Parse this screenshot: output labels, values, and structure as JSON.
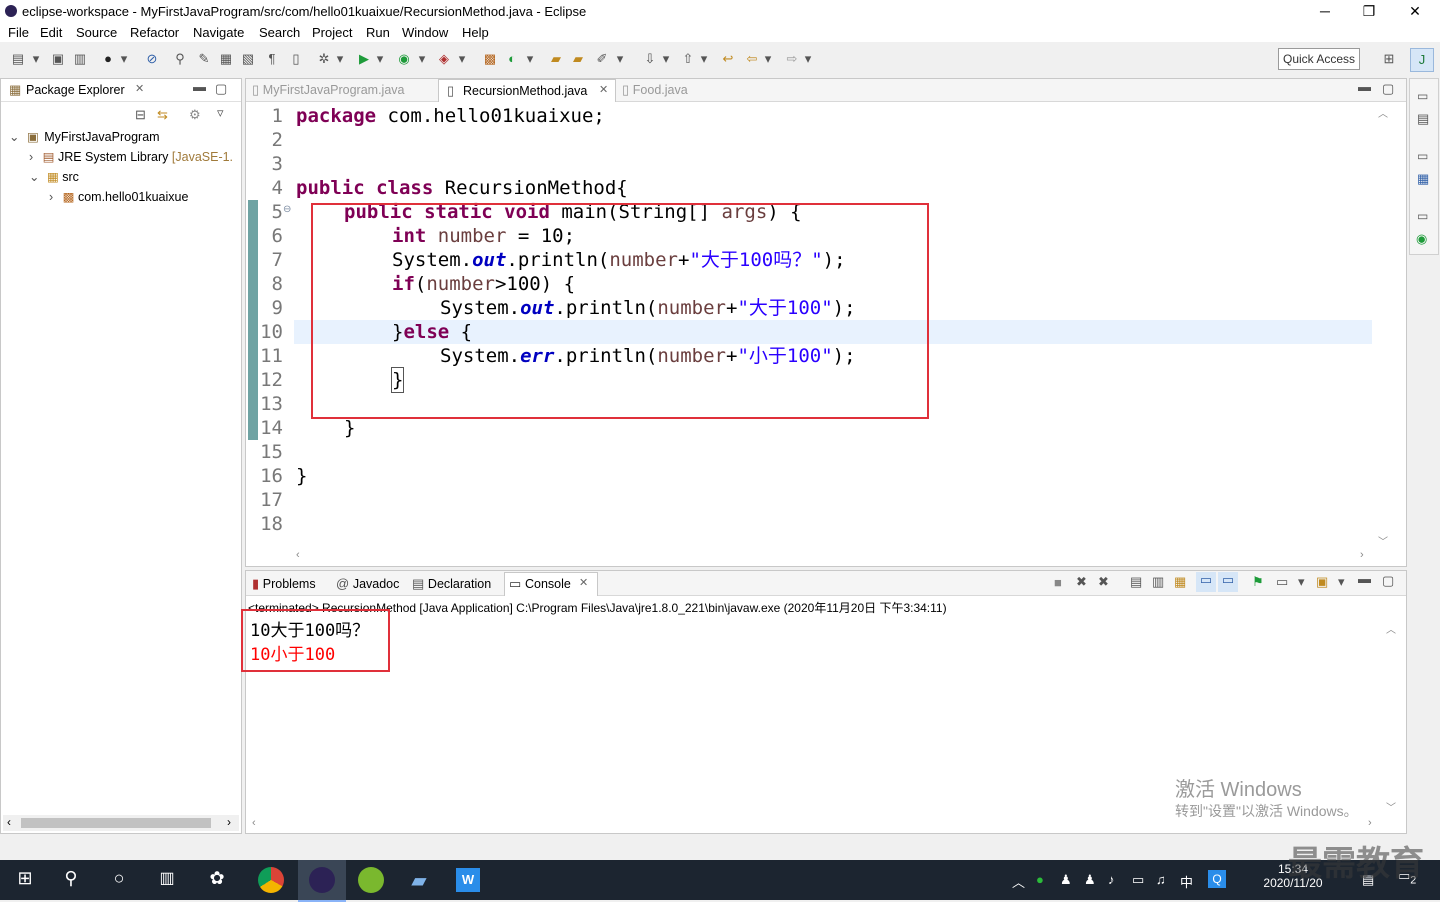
{
  "window": {
    "title": "eclipse-workspace - MyFirstJavaProgram/src/com/hello01kuaixue/RecursionMethod.java - Eclipse"
  },
  "menu": [
    "File",
    "Edit",
    "Source",
    "Refactor",
    "Navigate",
    "Search",
    "Project",
    "Run",
    "Window",
    "Help"
  ],
  "toolbar": {
    "quick_access": "Quick Access"
  },
  "package_explorer": {
    "tab": "Package Explorer",
    "tree": [
      {
        "label": "MyFirstJavaProgram",
        "level": 0,
        "expanded": true
      },
      {
        "label": "JRE System Library",
        "extra": "[JavaSE-1.",
        "level": 1,
        "expanded": false
      },
      {
        "label": "src",
        "level": 1,
        "expanded": true
      },
      {
        "label": "com.hello01kuaixue",
        "level": 2,
        "expanded": false
      }
    ]
  },
  "editor": {
    "tabs": [
      {
        "label": "MyFirstJavaProgram.java",
        "active": false
      },
      {
        "label": "RecursionMethod.java",
        "active": true
      },
      {
        "label": "Food.java",
        "active": false
      }
    ],
    "line_numbers": [
      "1",
      "2",
      "3",
      "4",
      "5",
      "6",
      "7",
      "8",
      "9",
      "10",
      "11",
      "12",
      "13",
      "14",
      "15",
      "16",
      "17",
      "18"
    ],
    "code": {
      "l1_kw": "package",
      "l1_rest": " com.hello01kuaixue;",
      "l4_kw": "public class",
      "l4_rest": " RecursionMethod{",
      "l5_kw": "public static void",
      "l5_rest": " main(String[] ",
      "l5_var": "args",
      "l5_end": ") {",
      "l6_kw": "int",
      "l6_var": " number",
      "l6_rest": " = 10;",
      "l7_a": "System.",
      "l7_it": "out",
      "l7_b": ".println(",
      "l7_var": "number",
      "l7_c": "+",
      "l7_str": "\"大于100吗？\"",
      "l7_d": ");",
      "l8_kw": "if",
      "l8_a": "(",
      "l8_var": "number",
      "l8_b": ">100) {",
      "l9_a": "System.",
      "l9_it": "out",
      "l9_b": ".println(",
      "l9_var": "number",
      "l9_c": "+",
      "l9_str": "\"大于100\"",
      "l9_d": ");",
      "l10_a": "}",
      "l10_kw": "else",
      "l10_b": " {",
      "l11_a": "System.",
      "l11_it": "err",
      "l11_b": ".println(",
      "l11_var": "number",
      "l11_c": "+",
      "l11_str": "\"小于100\"",
      "l11_d": ");",
      "l12": "}",
      "l14": "}",
      "l16": "}"
    }
  },
  "console": {
    "tabs": [
      {
        "label": "Problems",
        "active": false
      },
      {
        "label": "Javadoc",
        "active": false
      },
      {
        "label": "Declaration",
        "active": false
      },
      {
        "label": "Console",
        "active": true
      }
    ],
    "header": "<terminated> RecursionMethod [Java Application] C:\\Program Files\\Java\\jre1.8.0_221\\bin\\javaw.exe (2020年11月20日 下午3:34:11)",
    "output_line1": "10大于100吗？",
    "output_line2": "10小于100"
  },
  "watermark": {
    "line1": "激活 Windows",
    "line2": "转到\"设置\"以激活 Windows。"
  },
  "brand_watermark": "最需教育",
  "taskbar": {
    "time": "15:34",
    "date": "2020/11/20",
    "ime": "中",
    "notif_count": "2"
  },
  "colors": {
    "keyword": "#7f0055",
    "string": "#2a00ff",
    "field": "#0000c0",
    "highlight_box": "#e0303a",
    "stderr": "#ff0000"
  }
}
